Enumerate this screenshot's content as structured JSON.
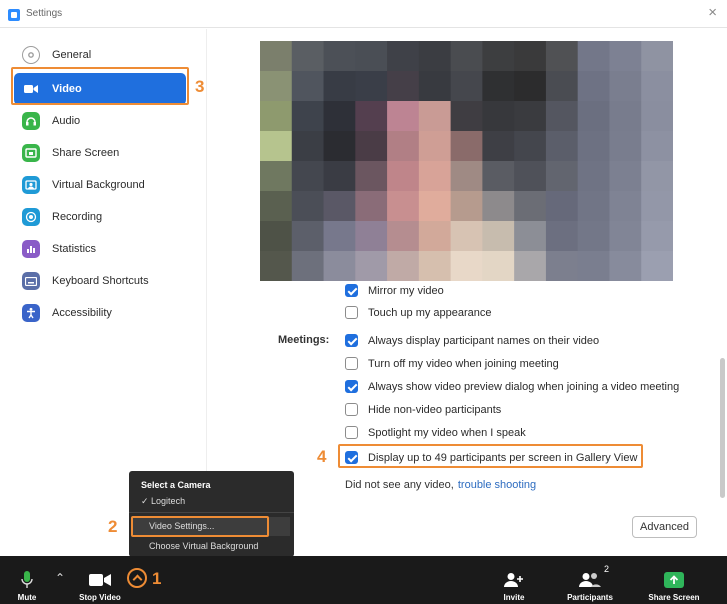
{
  "window": {
    "title": "Settings",
    "close_glyph": "×"
  },
  "sidebar": {
    "items": [
      {
        "label": "General",
        "icon": "gear-icon",
        "color": "#9e9e9e"
      },
      {
        "label": "Video",
        "icon": "video-camera-icon",
        "color": "#1f6fde",
        "active": true
      },
      {
        "label": "Audio",
        "icon": "headphones-icon",
        "color": "#39b54a"
      },
      {
        "label": "Share Screen",
        "icon": "share-screen-icon",
        "color": "#39b54a"
      },
      {
        "label": "Virtual Background",
        "icon": "virtual-background-icon",
        "color": "#1f9ad6"
      },
      {
        "label": "Recording",
        "icon": "recording-icon",
        "color": "#1f9ad6"
      },
      {
        "label": "Statistics",
        "icon": "statistics-icon",
        "color": "#8a5cc7"
      },
      {
        "label": "Keyboard Shortcuts",
        "icon": "keyboard-icon",
        "color": "#5b6fa8"
      },
      {
        "label": "Accessibility",
        "icon": "accessibility-icon",
        "color": "#3a64c9"
      }
    ]
  },
  "steps": {
    "s1": "1",
    "s2": "2",
    "s3": "3",
    "s4": "4"
  },
  "video": {
    "options": [
      {
        "label": "Mirror my video",
        "checked": true
      },
      {
        "label": "Touch up my appearance",
        "checked": false
      }
    ],
    "meetings_label": "Meetings:",
    "meeting_options": [
      {
        "label": "Always display participant names on their video",
        "checked": true
      },
      {
        "label": "Turn off my video when joining meeting",
        "checked": false
      },
      {
        "label": "Always show video preview dialog when joining a video meeting",
        "checked": true
      },
      {
        "label": "Hide non-video participants",
        "checked": false
      },
      {
        "label": "Spotlight my video when I speak",
        "checked": false
      },
      {
        "label": "Display up to 49 participants per screen in Gallery View",
        "checked": true
      }
    ],
    "help_text": "Did not see any video,",
    "help_link": "trouble shooting",
    "advanced_label": "Advanced"
  },
  "camera_menu": {
    "heading": "Select a Camera",
    "camera": "✓ Logitech",
    "video_settings": "Video Settings...",
    "virtual_background": "Choose Virtual Background"
  },
  "toolbar": {
    "mute": "Mute",
    "stop_video": "Stop Video",
    "invite": "Invite",
    "participants": "Participants",
    "participants_count": "2",
    "share_screen": "Share Screen"
  },
  "colors": {
    "accent": "#1f6fde",
    "highlight": "#ee8c35",
    "share_green": "#2fb55a"
  }
}
